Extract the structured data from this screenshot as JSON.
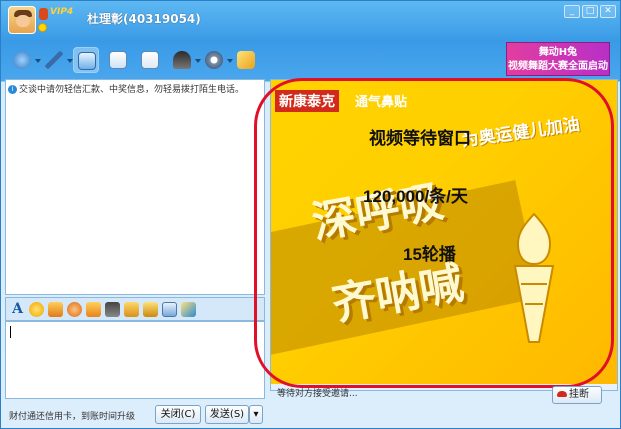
{
  "window": {
    "contact_name": "杜理彰(40319054)",
    "vip_label": "VIP4",
    "controls": {
      "minimize": "_",
      "maximize": "□",
      "close": "✕"
    }
  },
  "toolbar": {
    "icons": [
      "video-icon",
      "voice-icon",
      "share-screen-icon",
      "transfer-file-icon",
      "create-group-icon",
      "remote-assist-icon",
      "settings-icon",
      "app-icon"
    ],
    "promo_line1": "舞动H兔",
    "promo_line2": "视频舞蹈大赛全面启动"
  },
  "chat": {
    "notice": "交谈中请勿轻信汇款、中奖信息，勿轻易拨打陌生电话。"
  },
  "input_toolbar": {
    "font_label": "A",
    "icons": [
      "emoticon-icon",
      "magic-icon",
      "scrawl-icon",
      "shake-icon",
      "screenshot-icon",
      "image-icon",
      "music-icon",
      "history-icon",
      "more-icon"
    ]
  },
  "bottom": {
    "tip": "财付通还信用卡，到账时间升级",
    "close_label": "关闭(C)",
    "send_label": "发送(S)",
    "send_menu": "▾"
  },
  "video": {
    "ad_brand": "新康泰克",
    "ad_sub": "通气鼻贴",
    "ad_slogan": "为奥运健儿加油",
    "ad_big1": "深呼吸",
    "ad_big2": "齐呐喊",
    "overlay_title": "视频等待窗口",
    "overlay_price": "120,000/条/天",
    "overlay_rotation": "15轮播",
    "status": "等待对方接受邀请...",
    "hangup_label": "挂断"
  }
}
